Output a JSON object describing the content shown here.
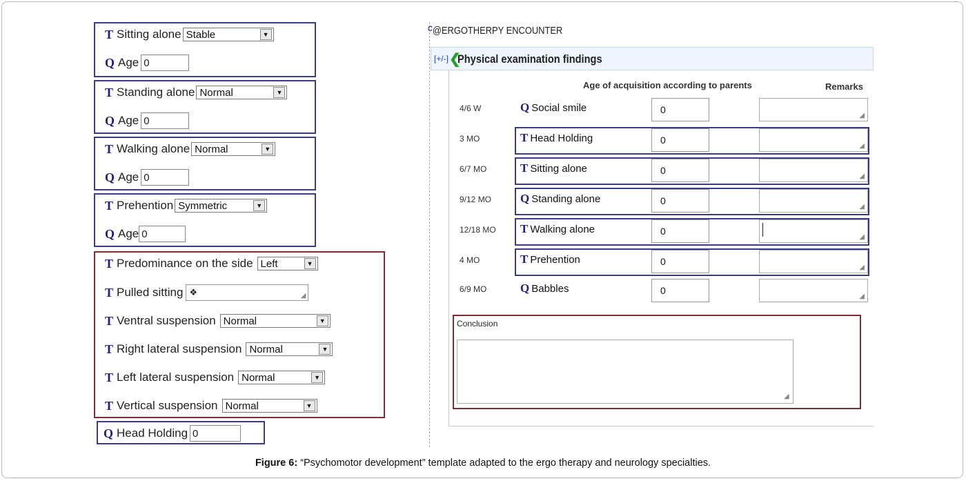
{
  "left_panel": {
    "groups": [
      {
        "rows": [
          {
            "type": "T",
            "label": "Sitting alone",
            "kind": "select",
            "value": "Stable"
          },
          {
            "type": "Q",
            "label": "Age",
            "kind": "input",
            "value": "0"
          }
        ]
      },
      {
        "rows": [
          {
            "type": "T",
            "label": "Standing alone",
            "kind": "select",
            "value": "Normal"
          },
          {
            "type": "Q",
            "label": "Age",
            "kind": "input",
            "value": "0"
          }
        ]
      },
      {
        "rows": [
          {
            "type": "T",
            "label": "Walking alone",
            "kind": "select",
            "value": "Normal"
          },
          {
            "type": "Q",
            "label": "Age",
            "kind": "input",
            "value": "0"
          }
        ]
      },
      {
        "rows": [
          {
            "type": "T",
            "label": "Prehention",
            "kind": "select",
            "value": "Symmetric"
          },
          {
            "type": "Q",
            "label": "Age",
            "kind": "input",
            "value": "0"
          }
        ]
      }
    ],
    "suspension_group": {
      "rows": [
        {
          "type": "T",
          "label": "Predominance on the side",
          "kind": "select",
          "value": "Left"
        },
        {
          "type": "T",
          "label": "Pulled sitting",
          "kind": "textarea",
          "value": "❖"
        },
        {
          "type": "T",
          "label": "Ventral suspension",
          "kind": "select",
          "value": "Normal"
        },
        {
          "type": "T",
          "label": "Right lateral suspension",
          "kind": "select",
          "value": "Normal"
        },
        {
          "type": "T",
          "label": "Left lateral suspension",
          "kind": "select",
          "value": "Normal"
        },
        {
          "type": "T",
          "label": "Vertical suspension",
          "kind": "select",
          "value": "Normal"
        }
      ]
    },
    "head_holding": {
      "type": "Q",
      "label": "Head Holding",
      "value": "0"
    }
  },
  "encounter": {
    "marker": "C",
    "title": "@ERGOTHERPY ENCOUNTER",
    "toggle": "[+/-]",
    "section_title": "Physical examination findings",
    "col_age_header": "Age of acquisition according to parents",
    "col_remarks_header": "Remarks",
    "rows": [
      {
        "age": "4/6 W",
        "type": "Q",
        "label": "Social smile",
        "value": "0",
        "remark": ""
      },
      {
        "age": "3 MO",
        "type": "T",
        "label": "Head Holding",
        "value": "0",
        "remark": ""
      },
      {
        "age": "6/7 MO",
        "type": "T",
        "label": "Sitting alone",
        "value": "0",
        "remark": ""
      },
      {
        "age": "9/12 MO",
        "type": "Q",
        "label": "Standing alone",
        "value": "0",
        "remark": ""
      },
      {
        "age": "12/18 MO",
        "type": "T",
        "label": "Walking alone",
        "value": "0",
        "remark": ""
      },
      {
        "age": "4 MO",
        "type": "T",
        "label": "Prehention",
        "value": "0",
        "remark": ""
      },
      {
        "age": "6/9 MO",
        "type": "Q",
        "label": "Babbles",
        "value": "0",
        "remark": ""
      }
    ],
    "conclusion_label": "Conclusion",
    "conclusion_value": ""
  },
  "caption": {
    "prefix": "Figure 6:",
    "text": " “Psychomotor development” template adapted to the ergo therapy and neurology specialties."
  },
  "colors": {
    "template_border": "#3b3b80",
    "group_border": "#7a2f33",
    "section_bg": "#eef5ff",
    "chevron": "#28a028"
  }
}
